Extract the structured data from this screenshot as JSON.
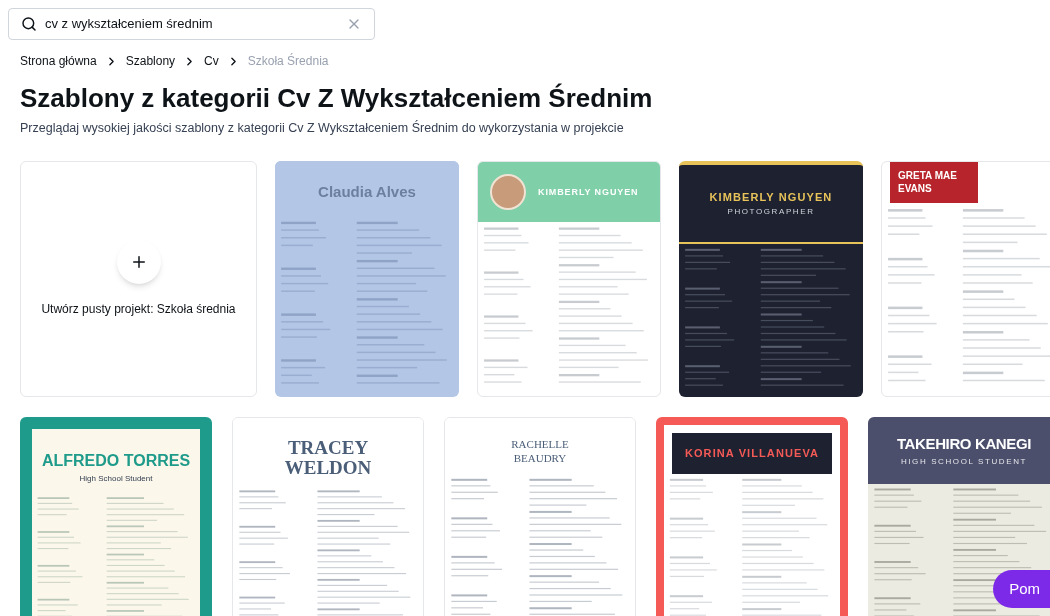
{
  "search": {
    "value": "cv z wykształceniem średnim"
  },
  "breadcrumb": [
    {
      "label": "Strona główna",
      "current": false
    },
    {
      "label": "Szablony",
      "current": false
    },
    {
      "label": "Cv",
      "current": false
    },
    {
      "label": "Szkoła Średnia",
      "current": true
    }
  ],
  "title": "Szablony z kategorii Cv Z Wykształceniem Średnim",
  "description": "Przeglądaj wysokiej jakości szablony z kategorii Cv Z Wykształceniem Średnim do wykorzystania w projekcie",
  "create_card": {
    "label": "Utwórz pusty projekt: Szkoła średnia"
  },
  "rows": [
    {
      "templates": [
        {
          "kind": "pastel",
          "name": "Claudia Alves"
        },
        {
          "kind": "mint",
          "name": "KIMBERLY NGUYEN"
        },
        {
          "kind": "night",
          "name": "KIMBERLY NGUYEN",
          "subtitle": "PHOTOGRAPHER"
        },
        {
          "kind": "crimson",
          "name": "GRETA MAE EVANS"
        }
      ]
    },
    {
      "templates": [
        {
          "kind": "confetti",
          "name": "ALFREDO TORRES",
          "subtitle": "High School Student"
        },
        {
          "kind": "classic",
          "name": "TRACEY WELDON"
        },
        {
          "kind": "framed",
          "name": "RACHELLE BEAUDRY"
        },
        {
          "kind": "coral",
          "name": "KORINA VILLANUEVA"
        },
        {
          "kind": "slate",
          "name": "TAKEHIRO KANEGI",
          "subtitle": "HIGH SCHOOL STUDENT"
        }
      ]
    }
  ],
  "help_button": {
    "label": "Pom"
  }
}
